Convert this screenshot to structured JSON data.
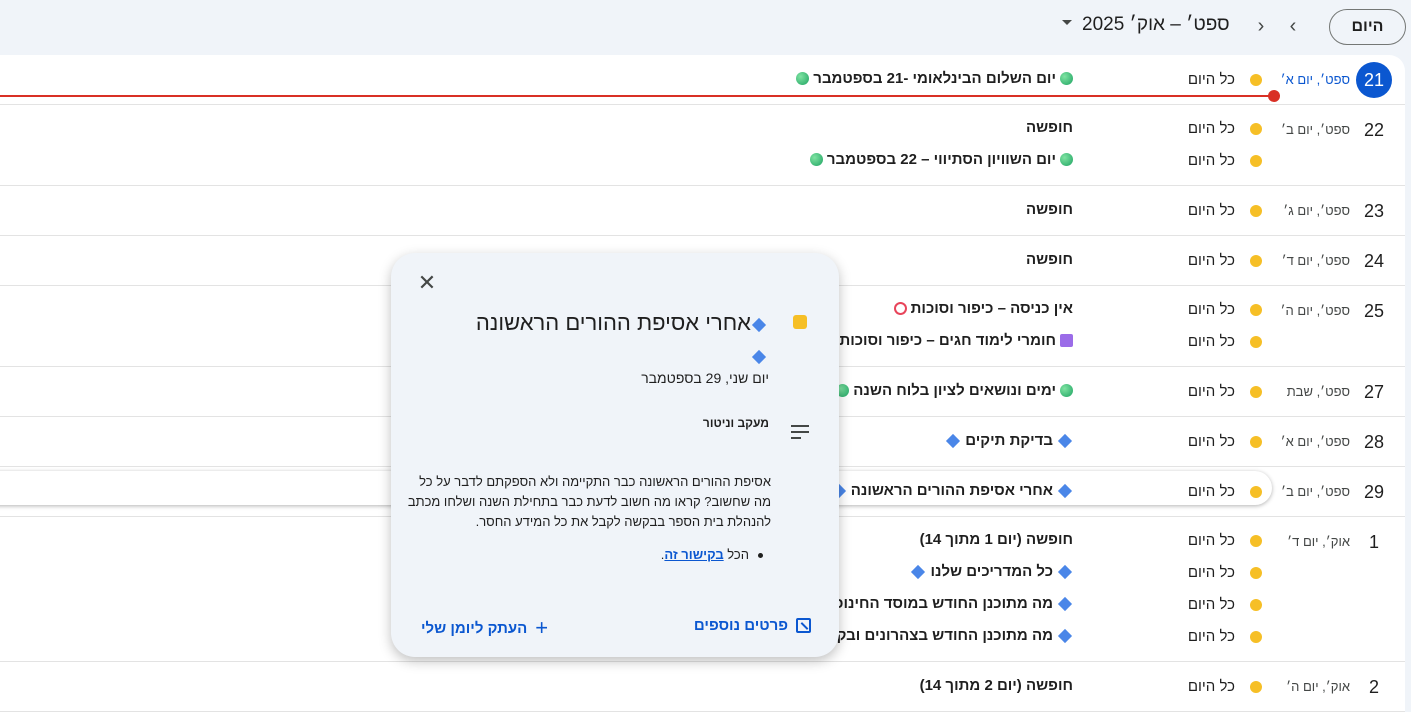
{
  "header": {
    "today_label": "היום",
    "prev_icon": "chevron-left-icon",
    "next_icon": "chevron-right-icon",
    "month_range": "ספט׳ – אוק׳ 2025"
  },
  "colors": {
    "accent": "#0b57d0",
    "event_yellow": "#f6bf26",
    "now_line": "#d93025",
    "popup_bg": "#f0f4f9"
  },
  "days": [
    {
      "num": "21",
      "label": "ספט׳, יום א׳",
      "today": true,
      "events": [
        {
          "allday": "כל היום",
          "title": "יום השלום הבינלאומי -21 בספטמבר",
          "pre": "g",
          "post": "g"
        }
      ]
    },
    {
      "num": "22",
      "label": "ספט׳, יום ב׳",
      "events": [
        {
          "allday": "כל היום",
          "title": "חופשה"
        },
        {
          "allday": "כל היום",
          "title": "יום השוויון הסתיווי – 22 בספטמבר",
          "pre": "g",
          "post": "g"
        }
      ]
    },
    {
      "num": "23",
      "label": "ספט׳, יום ג׳",
      "events": [
        {
          "allday": "כל היום",
          "title": "חופשה"
        }
      ]
    },
    {
      "num": "24",
      "label": "ספט׳, יום ד׳",
      "events": [
        {
          "allday": "כל היום",
          "title": "חופשה"
        }
      ]
    },
    {
      "num": "25",
      "label": "ספט׳, יום ה׳",
      "events": [
        {
          "allday": "כל היום",
          "title": "אין כניסה – כיפור וסוכות",
          "post": "ring"
        },
        {
          "allday": "כל היום",
          "title": "חומרי לימוד חגים – כיפור וסוכות",
          "pre": "sq",
          "post": "sq"
        }
      ]
    },
    {
      "num": "27",
      "label": "ספט׳, שבת",
      "events": [
        {
          "allday": "כל היום",
          "title": "ימים ונושאים לציון בלוח השנה",
          "pre": "g",
          "post": "g"
        }
      ]
    },
    {
      "num": "28",
      "label": "ספט׳, יום א׳",
      "events": [
        {
          "allday": "כל היום",
          "title": "בדיקת תיקים",
          "pre": "diam",
          "post": "diam"
        }
      ]
    },
    {
      "num": "29",
      "label": "ספט׳, יום ב׳",
      "events": [
        {
          "allday": "כל היום",
          "title": "אחרי אסיפת ההורים הראשונה",
          "pre": "diam",
          "post": "diam"
        }
      ]
    },
    {
      "num": "1",
      "label": "אוק׳, יום ד׳",
      "events": [
        {
          "allday": "כל היום",
          "title": "חופשה (יום 1 מתוך 14)"
        },
        {
          "allday": "כל היום",
          "title": "כל המדריכים שלנו",
          "pre": "diam",
          "post": "diam"
        },
        {
          "allday": "כל היום",
          "title": "מה מתוכנן החודש במוסד החינוכי?",
          "pre": "diam"
        },
        {
          "allday": "כל היום",
          "title": "מה מתוכנן החודש בצהרונים ובקייטנות",
          "pre": "diam"
        }
      ]
    },
    {
      "num": "2",
      "label": "אוק׳, יום ה׳",
      "events": [
        {
          "allday": "כל היום",
          "title": "חופשה (יום 2 מתוך 14)"
        }
      ]
    }
  ],
  "popup": {
    "close_icon": "close-icon",
    "title": "אחרי אסיפת ההורים הראשונה",
    "date": "יום שני, 29 בספטמבר",
    "subtitle": "מעקב וניטור",
    "body": "אסיפת ההורים הראשונה כבר התקיימה ולא הספקתם לדבר על כל מה שחשוב? קראו מה חשוב לדעת כבר בתחילת השנה ושלחו מכתב להנהלת בית הספר בבקשה לקבל את כל המידע החסר.",
    "bullet_prefix": "הכל",
    "bullet_link": "בקישור זה",
    "bullet_suffix": ".",
    "more_details": "פרטים נוספים",
    "copy_to_calendar": "העתק ליומן שלי"
  }
}
